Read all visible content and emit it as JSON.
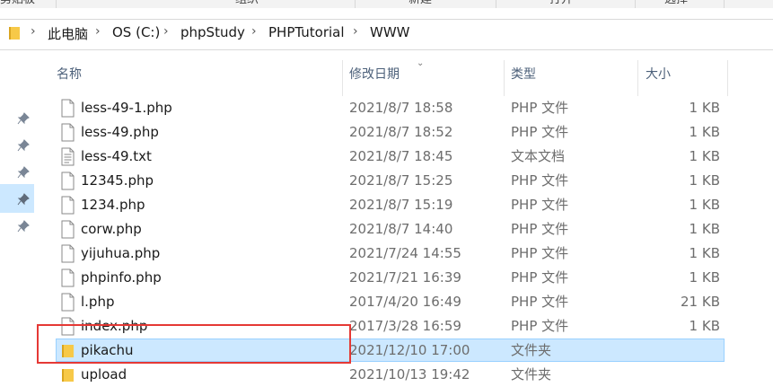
{
  "ribbon": {
    "groups": [
      "剪贴板",
      "组织",
      "新建",
      "打开",
      "选择"
    ]
  },
  "address": {
    "crumbs": [
      "此电脑",
      "OS (C:)",
      "phpStudy",
      "PHPTutorial",
      "WWW"
    ],
    "separator": "›"
  },
  "columns": {
    "name": "名称",
    "date": "修改日期",
    "type": "类型",
    "size": "大小"
  },
  "files": [
    {
      "name": "less-49-1.php",
      "date": "2021/8/7 18:58",
      "type": "PHP 文件",
      "size": "1 KB",
      "icon": "php-file-icon"
    },
    {
      "name": "less-49.php",
      "date": "2021/8/7 18:52",
      "type": "PHP 文件",
      "size": "1 KB",
      "icon": "php-file-icon"
    },
    {
      "name": "less-49.txt",
      "date": "2021/8/7 18:45",
      "type": "文本文档",
      "size": "1 KB",
      "icon": "text-file-icon"
    },
    {
      "name": "12345.php",
      "date": "2021/8/7 15:25",
      "type": "PHP 文件",
      "size": "1 KB",
      "icon": "php-file-icon"
    },
    {
      "name": "1234.php",
      "date": "2021/8/7 15:19",
      "type": "PHP 文件",
      "size": "1 KB",
      "icon": "php-file-icon"
    },
    {
      "name": "corw.php",
      "date": "2021/8/7 14:40",
      "type": "PHP 文件",
      "size": "1 KB",
      "icon": "php-file-icon"
    },
    {
      "name": "yijuhua.php",
      "date": "2021/7/24 14:55",
      "type": "PHP 文件",
      "size": "1 KB",
      "icon": "php-file-icon"
    },
    {
      "name": "phpinfo.php",
      "date": "2021/7/21 16:39",
      "type": "PHP 文件",
      "size": "1 KB",
      "icon": "php-file-icon"
    },
    {
      "name": "l.php",
      "date": "2017/4/20 16:49",
      "type": "PHP 文件",
      "size": "21 KB",
      "icon": "php-file-icon"
    },
    {
      "name": "index.php",
      "date": "2017/3/28 16:59",
      "type": "PHP 文件",
      "size": "1 KB",
      "icon": "php-file-icon"
    },
    {
      "name": "pikachu",
      "date": "2021/12/10 17:00",
      "type": "文件夹",
      "size": "",
      "icon": "folder-icon",
      "selected": true
    },
    {
      "name": "upload",
      "date": "2021/10/13 19:42",
      "type": "文件夹",
      "size": "",
      "icon": "folder-icon"
    }
  ],
  "colors": {
    "selection_bg": "#cce8ff",
    "selection_border": "#99d1ff",
    "annotation": "#e53935",
    "folder": "#f7c948"
  }
}
